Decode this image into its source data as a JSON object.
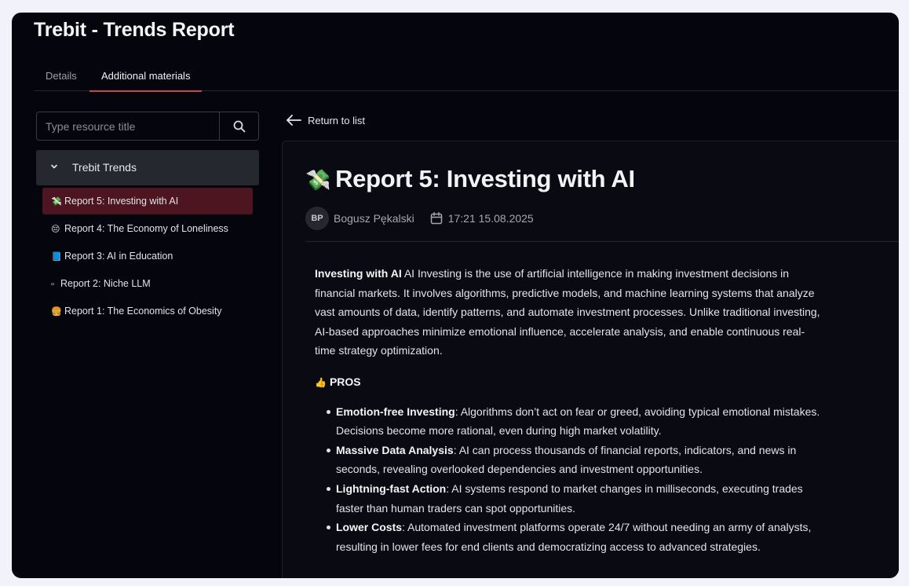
{
  "app": {
    "title": "Trebit - Trends Report"
  },
  "tabs": [
    {
      "label": "Details",
      "active": false
    },
    {
      "label": "Additional materials",
      "active": true
    }
  ],
  "sidebar": {
    "search_placeholder": "Type resource title",
    "group_label": "Trebit Trends",
    "items": [
      {
        "emoji": "💸",
        "label": "Report 5: Investing with AI",
        "active": true
      },
      {
        "emoji": "😔",
        "label": "Report 4: The Economy of Loneliness",
        "active": false
      },
      {
        "emoji": "📘",
        "label": "Report 3: AI in Education",
        "active": false
      },
      {
        "emoji": "▫",
        "label": "Report 2: Niche LLM",
        "active": false
      },
      {
        "emoji": "🍔",
        "label": "Report 1: The Economics of Obesity",
        "active": false
      }
    ]
  },
  "main": {
    "return_label": "Return to list",
    "title_emoji": "💸",
    "title": "Report 5: Investing with AI",
    "author_initials": "BP",
    "author": "Bogusz Pękalski",
    "datetime": "17:21 15.08.2025",
    "intro_bold": "Investing with AI",
    "intro_text": " AI Investing is the use of artificial intelligence in making investment decisions in financial markets. It involves algorithms, predictive models, and machine learning systems that analyze vast amounts of data, identify patterns, and automate investment processes. Unlike traditional investing, AI-based approaches minimize emotional influence, accelerate analysis, and enable continuous real-time strategy optimization.",
    "pros_emoji": "👍",
    "pros_label": "PROS",
    "pros": [
      {
        "title": "Emotion-free Investing",
        "text": ": Algorithms don’t act on fear or greed, avoiding typical emotional mistakes. Decisions become more rational, even during high market volatility."
      },
      {
        "title": "Massive Data Analysis",
        "text": ": AI can process thousands of financial reports, indicators, and news in seconds, revealing overlooked dependencies and investment opportunities."
      },
      {
        "title": "Lightning-fast Action",
        "text": ": AI systems respond to market changes in milliseconds, executing trades faster than human traders can spot opportunities."
      },
      {
        "title": "Lower Costs",
        "text": ": Automated investment platforms operate 24/7 without needing an army of analysts, resulting in lower fees for end clients and democratizing access to advanced strategies."
      }
    ]
  },
  "colors": {
    "background": "#05060d",
    "accent": "#c5484c",
    "active_item": "#4c1520"
  }
}
